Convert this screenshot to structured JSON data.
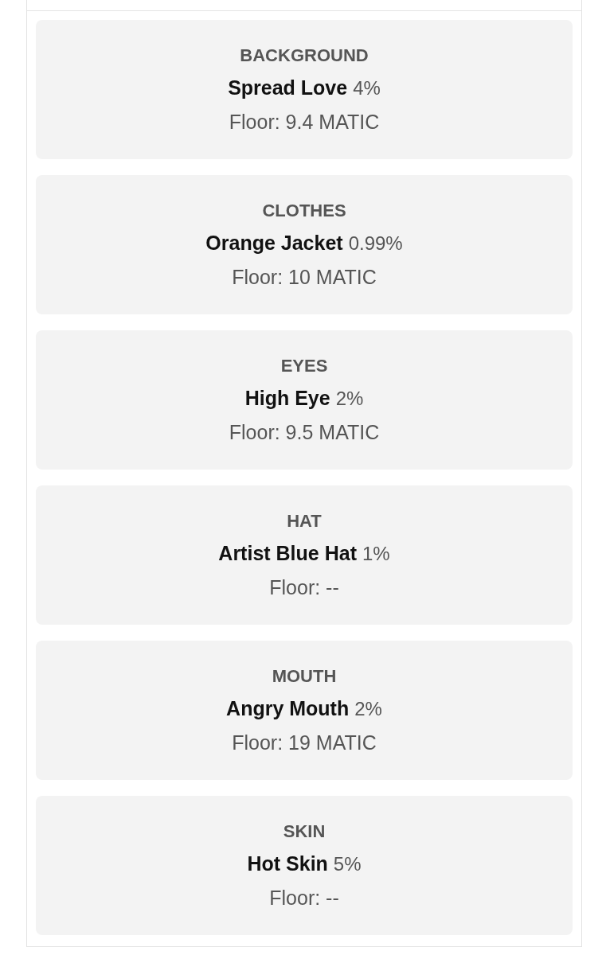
{
  "traits": [
    {
      "type": "BACKGROUND",
      "value": "Spread Love",
      "rarity": "4%",
      "floor": "Floor: 9.4 MATIC"
    },
    {
      "type": "CLOTHES",
      "value": "Orange Jacket",
      "rarity": "0.99%",
      "floor": "Floor: 10 MATIC"
    },
    {
      "type": "EYES",
      "value": "High Eye",
      "rarity": "2%",
      "floor": "Floor: 9.5 MATIC"
    },
    {
      "type": "HAT",
      "value": "Artist Blue Hat",
      "rarity": "1%",
      "floor": "Floor: --"
    },
    {
      "type": "MOUTH",
      "value": "Angry Mouth",
      "rarity": "2%",
      "floor": "Floor: 19 MATIC"
    },
    {
      "type": "SKIN",
      "value": "Hot Skin",
      "rarity": "5%",
      "floor": "Floor: --"
    }
  ]
}
